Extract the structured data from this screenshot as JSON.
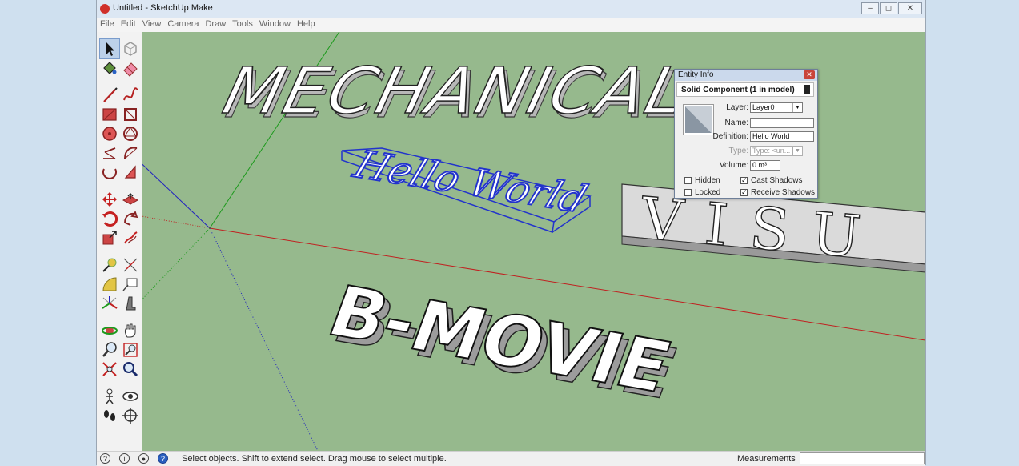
{
  "window": {
    "title": "Untitled - SketchUp Make"
  },
  "menu": [
    "File",
    "Edit",
    "View",
    "Camera",
    "Draw",
    "Tools",
    "Window",
    "Help"
  ],
  "model": {
    "text_top": "MECHANICAL",
    "text_middle": "Hello World",
    "text_right": "VISU",
    "text_bottom": "B-MOVIE"
  },
  "entity_info": {
    "title": "Entity Info",
    "header": "Solid Component (1 in model)",
    "layer_label": "Layer:",
    "layer_value": "Layer0",
    "name_label": "Name:",
    "name_value": "",
    "definition_label": "Definition:",
    "definition_value": "Hello World",
    "type_label": "Type:",
    "type_value": "Type: <un...",
    "volume_label": "Volume:",
    "volume_value": "0 m³",
    "hidden_label": "Hidden",
    "locked_label": "Locked",
    "cast_shadows_label": "Cast Shadows",
    "receive_shadows_label": "Receive Shadows"
  },
  "status": {
    "text": "Select objects. Shift to extend select. Drag mouse to select multiple.",
    "measurements_label": "Measurements"
  },
  "colors": {
    "viewport": "#96b98d",
    "selection": "#2233cc",
    "axis_red": "#c02020",
    "axis_green": "#1c9a1c",
    "axis_blue": "#2020c0"
  }
}
